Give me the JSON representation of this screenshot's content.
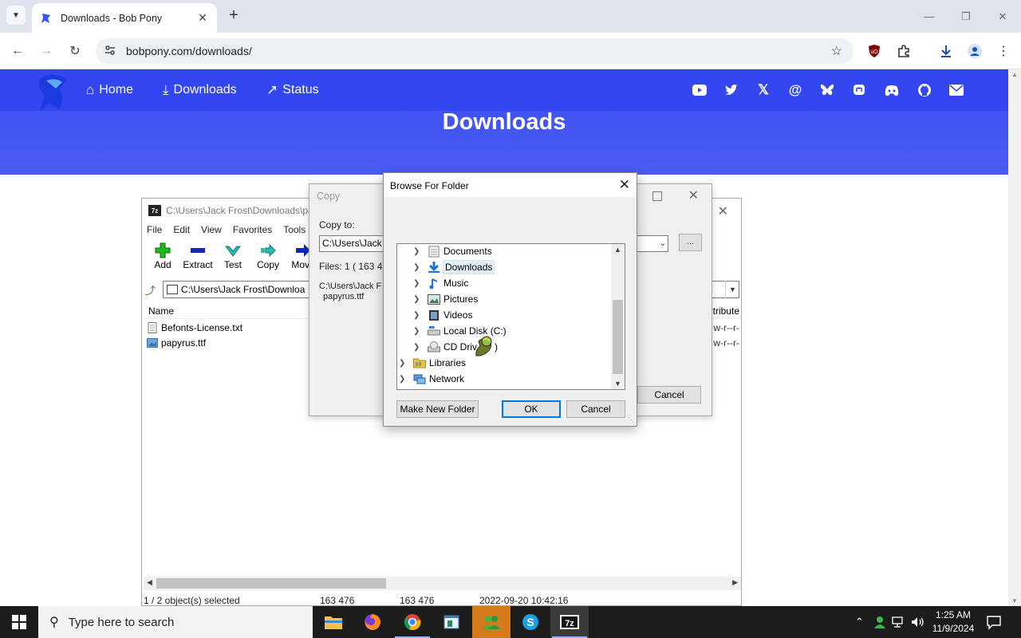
{
  "browser": {
    "tab_title": "Downloads - Bob Pony",
    "url": "bobpony.com/downloads/"
  },
  "site": {
    "nav": [
      {
        "label": "Home",
        "icon": "home-icon"
      },
      {
        "label": "Downloads",
        "icon": "download-icon"
      },
      {
        "label": "Status",
        "icon": "status-icon"
      }
    ],
    "social_icons": [
      "youtube-icon",
      "twitter-icon",
      "x-icon",
      "threads-icon",
      "bluesky-icon",
      "mastodon-icon",
      "discord-icon",
      "github-icon",
      "mail-icon"
    ],
    "page_title": "Downloads",
    "brand_color": "#3446ef"
  },
  "zip": {
    "title": "C:\\Users\\Jack Frost\\Downloads\\pa",
    "menu": [
      "File",
      "Edit",
      "View",
      "Favorites",
      "Tools"
    ],
    "tools": [
      "Add",
      "Extract",
      "Test",
      "Copy",
      "Move"
    ],
    "address": "C:\\Users\\Jack Frost\\Downloa",
    "col_name": "Name",
    "col_attr": "tribute",
    "files": [
      {
        "name": "Befonts-License.txt",
        "attr": "w-r--r-"
      },
      {
        "name": "papyrus.ttf",
        "attr": "w-r--r-"
      }
    ],
    "status": {
      "selected": "1 / 2 object(s) selected",
      "size1": "163 476",
      "size2": "163 476",
      "modified": "2022-09-20 10:42:16"
    }
  },
  "copy": {
    "title": "Copy",
    "copy_to_label": "Copy to:",
    "path": "C:\\Users\\Jack F",
    "browse": "...",
    "files_line": "Files: 1    ( 163 47",
    "src_path": "C:\\Users\\Jack F",
    "src_file": "papyrus.ttf",
    "cancel": "Cancel"
  },
  "browse": {
    "title": "Browse For Folder",
    "items": [
      {
        "label": "Documents",
        "icon": "documents-icon"
      },
      {
        "label": "Downloads",
        "icon": "downloads-folder-icon"
      },
      {
        "label": "Music",
        "icon": "music-icon"
      },
      {
        "label": "Pictures",
        "icon": "pictures-icon"
      },
      {
        "label": "Videos",
        "icon": "videos-icon"
      },
      {
        "label": "Local Disk (C:)",
        "icon": "local-disk-icon"
      },
      {
        "label": "CD Drive (D:)",
        "icon": "cd-drive-icon"
      },
      {
        "label": "Libraries",
        "icon": "libraries-icon"
      },
      {
        "label": "Network",
        "icon": "network-icon"
      }
    ],
    "cd_visible": "CD Driv",
    "cd_tail": ")",
    "make_new_folder": "Make New Folder",
    "ok": "OK",
    "cancel": "Cancel"
  },
  "taskbar": {
    "search_placeholder": "Type here to search",
    "time": "1:25 AM",
    "date": "11/9/2024"
  }
}
